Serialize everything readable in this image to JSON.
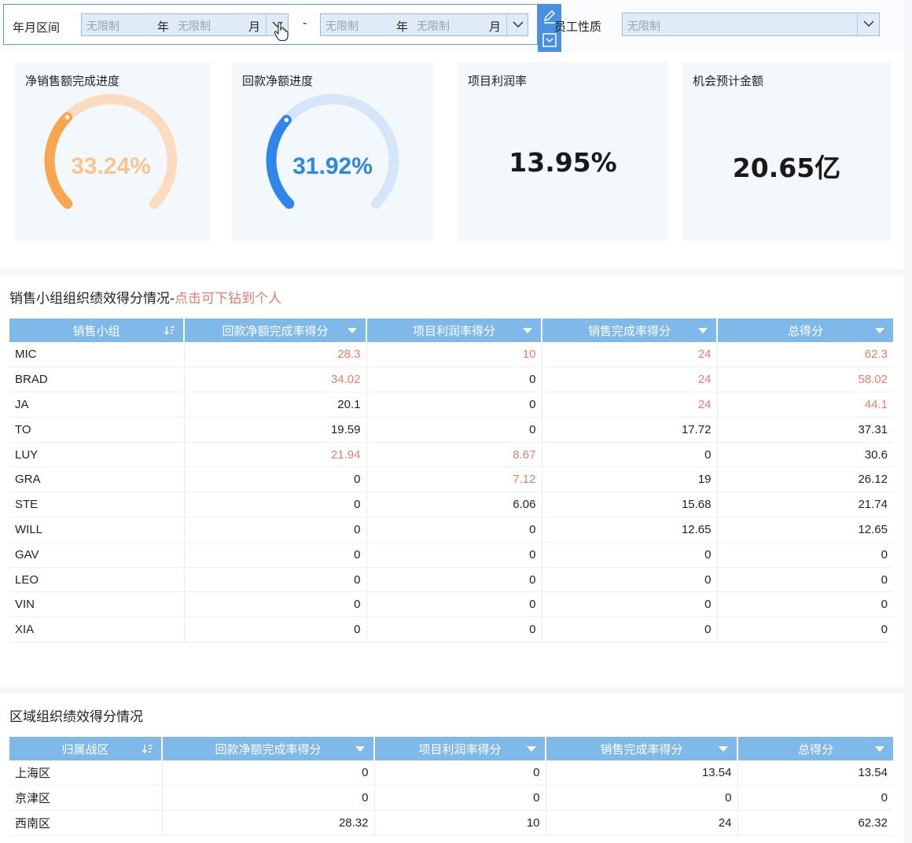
{
  "filters": {
    "date_range_label": "年月区间",
    "unlimited": "无限制",
    "year_unit": "年",
    "month_unit": "月",
    "range_separator": "-",
    "staff_label": "员工性质",
    "staff_value": "无限制"
  },
  "kpis": [
    {
      "title": "净销售额完成进度",
      "value": "33.24%",
      "progress": 0.3324,
      "color": "#f9a650",
      "track": "#fcdcc0",
      "text_color": "#fbc48e"
    },
    {
      "title": "回款净额进度",
      "value": "31.92%",
      "progress": 0.3192,
      "color": "#2f86ea",
      "track": "#d6e6f8",
      "text_color": "#2f86ea"
    },
    {
      "title": "项目利润率",
      "value": "13.95%"
    },
    {
      "title": "机会预计金额",
      "value": "20.65亿"
    }
  ],
  "sales_table": {
    "title": "销售小组组织绩效得分情况-",
    "title_link": "点击可下钻到个人",
    "columns": [
      "销售小组",
      "回款净额完成率得分",
      "项目利润率得分",
      "销售完成率得分",
      "总得分"
    ],
    "rows": [
      [
        "MIC",
        "28.3",
        "10",
        "24",
        "62.3"
      ],
      [
        "BRAD",
        "34.02",
        "0",
        "24",
        "58.02"
      ],
      [
        "JA",
        "20.1",
        "0",
        "24",
        "44.1"
      ],
      [
        "TO",
        "19.59",
        "0",
        "17.72",
        "37.31"
      ],
      [
        "LUY",
        "21.94",
        "8.67",
        "0",
        "30.6"
      ],
      [
        "GRA",
        "0",
        "7.12",
        "19",
        "26.12"
      ],
      [
        "STE",
        "0",
        "6.06",
        "15.68",
        "21.74"
      ],
      [
        "WILL",
        "0",
        "0",
        "12.65",
        "12.65"
      ],
      [
        "GAV",
        "0",
        "0",
        "0",
        "0"
      ],
      [
        "LEO",
        "0",
        "0",
        "0",
        "0"
      ],
      [
        "VIN",
        "0",
        "0",
        "0",
        "0"
      ],
      [
        "XIA",
        "0",
        "0",
        "0",
        "0"
      ]
    ],
    "highlight": [
      [
        0,
        1
      ],
      [
        0,
        2
      ],
      [
        0,
        3
      ],
      [
        0,
        4
      ],
      [
        1,
        1
      ],
      [
        1,
        3
      ],
      [
        1,
        4
      ],
      [
        2,
        3
      ],
      [
        2,
        4
      ],
      [
        4,
        1
      ],
      [
        4,
        2
      ],
      [
        5,
        2
      ]
    ],
    "highlight_color": "#ee7a6c"
  },
  "region_table": {
    "title": "区域组织绩效得分情况",
    "columns": [
      "归属战区",
      "回款净额完成率得分",
      "项目利润率得分",
      "销售完成率得分",
      "总得分"
    ],
    "rows": [
      [
        "上海区",
        "0",
        "0",
        "13.54",
        "13.54"
      ],
      [
        "京津区",
        "0",
        "0",
        "0",
        "0"
      ],
      [
        "西南区",
        "28.32",
        "10",
        "24",
        "62.32"
      ]
    ]
  }
}
